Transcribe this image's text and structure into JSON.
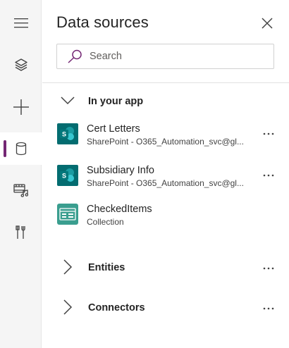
{
  "rail": {
    "items": [
      {
        "name": "hamburger-menu",
        "icon": "hamburger-icon"
      },
      {
        "name": "tree-view",
        "icon": "layers-icon"
      },
      {
        "name": "insert",
        "icon": "plus-icon"
      },
      {
        "name": "data",
        "icon": "database-icon",
        "active": true
      },
      {
        "name": "media",
        "icon": "media-icon"
      },
      {
        "name": "advanced-tools",
        "icon": "tools-icon"
      }
    ],
    "accent": "#742774"
  },
  "panel": {
    "title": "Data sources",
    "close_icon": "close-icon",
    "search": {
      "placeholder": "Search",
      "value": ""
    }
  },
  "sections": {
    "in_your_app": {
      "label": "In your app",
      "expanded": true,
      "items": [
        {
          "name": "Cert Letters",
          "subtitle": "SharePoint - O365_Automation_svc@gl...",
          "icon": "sharepoint-icon"
        },
        {
          "name": "Subsidiary Info",
          "subtitle": "SharePoint - O365_Automation_svc@gl...",
          "icon": "sharepoint-icon"
        },
        {
          "name": "CheckedItems",
          "subtitle": "Collection",
          "icon": "collection-icon"
        }
      ]
    },
    "entities": {
      "label": "Entities",
      "expanded": false
    },
    "connectors": {
      "label": "Connectors",
      "expanded": false
    }
  },
  "colors": {
    "sharepoint_teal": "#036c70",
    "collection_teal": "#3a9e8f",
    "text": "#242424"
  }
}
